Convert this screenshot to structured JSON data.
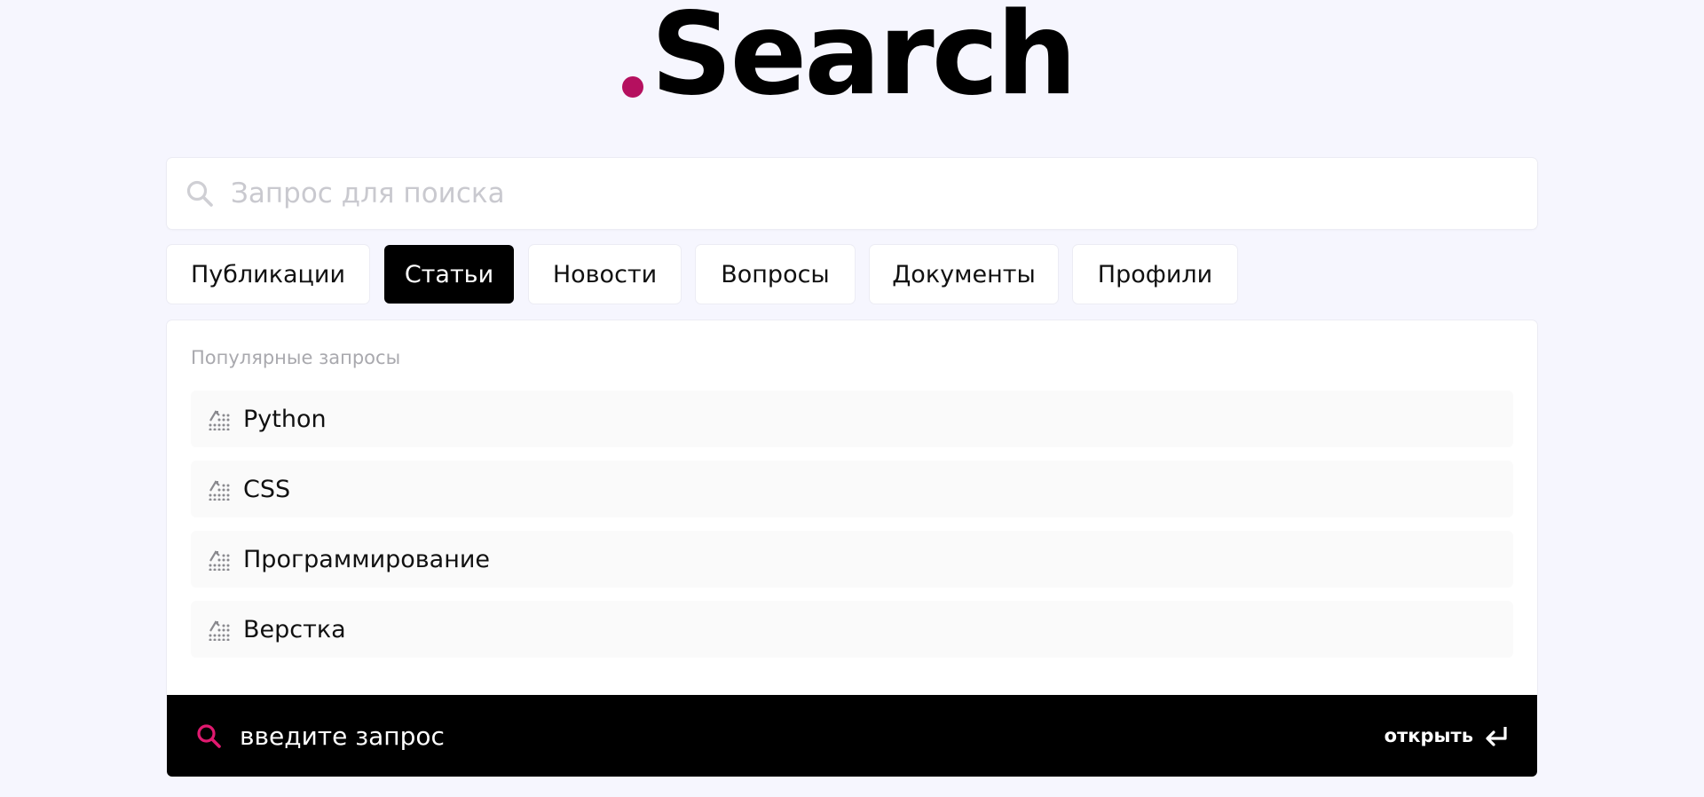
{
  "logo": {
    "text": "Search",
    "dot_color": "#b5105f"
  },
  "search": {
    "placeholder": "Запрос для поиска",
    "value": "",
    "icon": "search-icon"
  },
  "tabs": [
    {
      "label": "Публикации",
      "active": false
    },
    {
      "label": "Статьи",
      "active": true
    },
    {
      "label": "Новости",
      "active": false
    },
    {
      "label": "Вопросы",
      "active": false
    },
    {
      "label": "Документы",
      "active": false
    },
    {
      "label": "Профили",
      "active": false
    }
  ],
  "popular": {
    "title": "Популярные запросы",
    "icon": "trending-icon",
    "items": [
      {
        "label": "Python"
      },
      {
        "label": "CSS"
      },
      {
        "label": "Программирование"
      },
      {
        "label": "Верстка"
      }
    ]
  },
  "bar": {
    "query": "введите запрос",
    "open_label": "открыть",
    "icon_color": "#e0196f",
    "open_icon": "enter-icon"
  },
  "colors": {
    "background": "#f6f6fe",
    "accent": "#b5105f",
    "active_tab": "#000000"
  }
}
